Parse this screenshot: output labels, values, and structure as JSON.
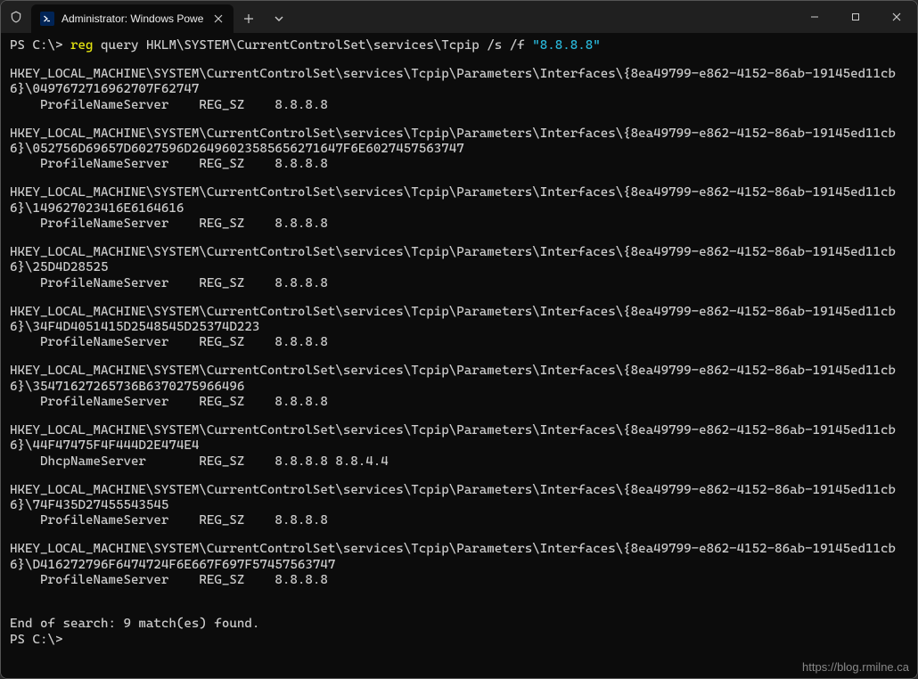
{
  "window": {
    "tab_title": "Administrator: Windows Powe",
    "prompt_prefix": "PS C:\\>",
    "command": {
      "exe": "reg",
      "args_gray": " query HKLM\\SYSTEM\\CurrentControlSet\\services\\Tcpip /s /f ",
      "quoted": "\"8.8.8.8\""
    },
    "registry_base_path": "HKEY_LOCAL_MACHINE\\SYSTEM\\CurrentControlSet\\services\\Tcpip\\Parameters\\Interfaces\\{8ea49799-e862-4152-86ab-19145ed11cb6}\\",
    "entries": [
      {
        "suffix": "0497672716962707F62747",
        "value_name": "ProfileNameServer",
        "type": "REG_SZ",
        "data": "8.8.8.8"
      },
      {
        "suffix": "052756D69657D6027596D26496023585656271647F6E6027457563747",
        "value_name": "ProfileNameServer",
        "type": "REG_SZ",
        "data": "8.8.8.8"
      },
      {
        "suffix": "149627023416E6164616",
        "value_name": "ProfileNameServer",
        "type": "REG_SZ",
        "data": "8.8.8.8"
      },
      {
        "suffix": "25D4D28525",
        "value_name": "ProfileNameServer",
        "type": "REG_SZ",
        "data": "8.8.8.8"
      },
      {
        "suffix": "34F4D4051415D2548545D25374D223",
        "value_name": "ProfileNameServer",
        "type": "REG_SZ",
        "data": "8.8.8.8"
      },
      {
        "suffix": "35471627265736B6370275966496",
        "value_name": "ProfileNameServer",
        "type": "REG_SZ",
        "data": "8.8.8.8"
      },
      {
        "suffix": "44F47475F4F444D2E474E4",
        "value_name": "DhcpNameServer",
        "type": "REG_SZ",
        "data": "8.8.8.8 8.8.4.4"
      },
      {
        "suffix": "74F435D27455543545",
        "value_name": "ProfileNameServer",
        "type": "REG_SZ",
        "data": "8.8.8.8"
      },
      {
        "suffix": "D416272796F6474724F6E667F697F57457563747",
        "value_name": "ProfileNameServer",
        "type": "REG_SZ",
        "data": "8.8.8.8"
      }
    ],
    "summary": "End of search: 9 match(es) found.",
    "next_prompt": "PS C:\\>",
    "watermark": "https://blog.rmilne.ca"
  }
}
